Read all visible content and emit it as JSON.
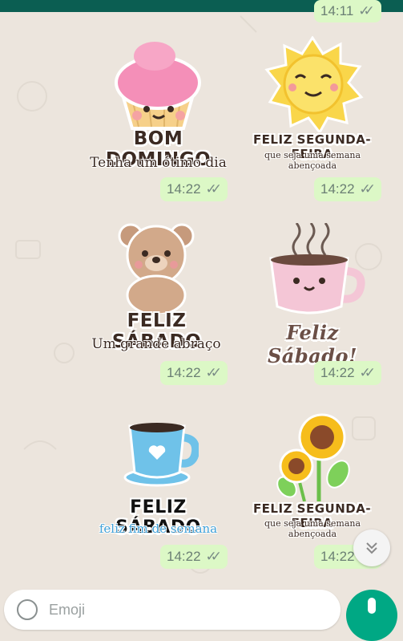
{
  "chat": {
    "messages": [
      {
        "title": "BOM DOMINGO",
        "subtitle": "Tenha um ótimo dia",
        "time": "14:22"
      },
      {
        "title": "FELIZ SEGUNDA-FEIRA",
        "subtitle": "que seja uma semana abençoada",
        "time": "14:22"
      },
      {
        "title": "FELIZ SÁBADO",
        "subtitle": "Um grande abraço",
        "time": "14:22"
      },
      {
        "title": "Feliz Sábado!",
        "subtitle": "",
        "time": "14:22"
      },
      {
        "title": "FELIZ SÁBADO",
        "subtitle": "feliz fim de semana",
        "time": "14:22"
      },
      {
        "title": "FELIZ SEGUNDA-FEIRA",
        "subtitle": "que seja uma semana abençoada",
        "time": "14:22"
      }
    ],
    "top_partial_time": "14:11"
  },
  "composer": {
    "placeholder": "Emoji",
    "icons": [
      "emoji-icon",
      "attach-icon",
      "camera-icon",
      "mic-icon"
    ]
  },
  "colors": {
    "bubble": "#dcf8c6",
    "accent": "#00a884",
    "header": "#0b5e52"
  }
}
